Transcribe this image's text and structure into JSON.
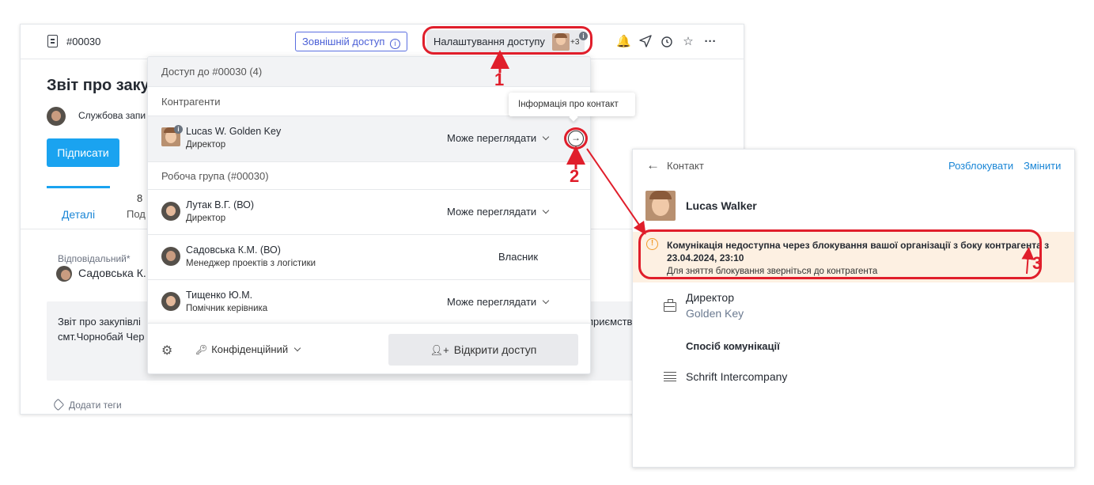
{
  "topbar": {
    "doc_number": "#00030",
    "external_access_label": "Зовнішній доступ",
    "access_settings_label": "Налаштування доступу",
    "access_avatar_extra": "+3"
  },
  "document": {
    "title": "Звіт про заку",
    "memo_type": "Службова запи",
    "sign_button": "Підписати",
    "tab_details": "Деталі",
    "tab_events_count": "8",
    "tab_events_label": "Под",
    "responsible_label": "Відповідальний*",
    "responsible_name": "Садовська К.",
    "description_line1": "Звіт про закупівлі",
    "description_line1_end": "приємств",
    "description_line2": "смт.Чорнобай Чер",
    "add_tags": "Додати теги"
  },
  "access_panel": {
    "header": "Доступ до #00030 (4)",
    "section_counterparties": "Контрагенти",
    "section_workgroup": "Робоча група (#00030)",
    "counterparties": [
      {
        "name": "Lucas W.  Golden Key",
        "role": "Директор",
        "permission": "Може переглядати"
      }
    ],
    "workgroup": [
      {
        "name": "Лутак В.Г. (ВО)",
        "role": "Директор",
        "permission": "Може переглядати"
      },
      {
        "name": "Садовська К.М. (ВО)",
        "role": "Менеджер проектів з логістики",
        "permission": "Власник"
      },
      {
        "name": "Тищенко Ю.М.",
        "role": "Помічник керівника",
        "permission": "Може переглядати"
      }
    ],
    "confidential_label": "Конфіденційний",
    "open_access_button": "Відкрити доступ"
  },
  "tooltip": "Інформація про контакт",
  "contact_panel": {
    "header": "Контакт",
    "unlock_link": "Розблокувати",
    "edit_link": "Змінити",
    "name": "Lucas Walker",
    "warning_line1": "Комунікація недоступна через блокування вашої організації з боку контрагента з",
    "warning_line2": "23.04.2024, 23:10",
    "warning_line3": "Для зняття блокування зверніться до контрагента",
    "position": "Директор",
    "company": "Golden Key",
    "comm_heading": "Спосіб комунікації",
    "comm_method": "Schrift Intercompany"
  },
  "annotations": {
    "step1": "1",
    "step2": "2",
    "step3": "3",
    "color": "#e01e2b"
  },
  "icons": [
    "document-icon",
    "info-icon",
    "bell-icon",
    "send-icon",
    "alarm-icon",
    "star-icon",
    "more-icon",
    "arrow-right-circle-icon",
    "gear-icon",
    "key-icon",
    "add-user-icon",
    "back-arrow-icon",
    "warning-icon",
    "briefcase-icon",
    "list-icon",
    "tag-icon"
  ]
}
